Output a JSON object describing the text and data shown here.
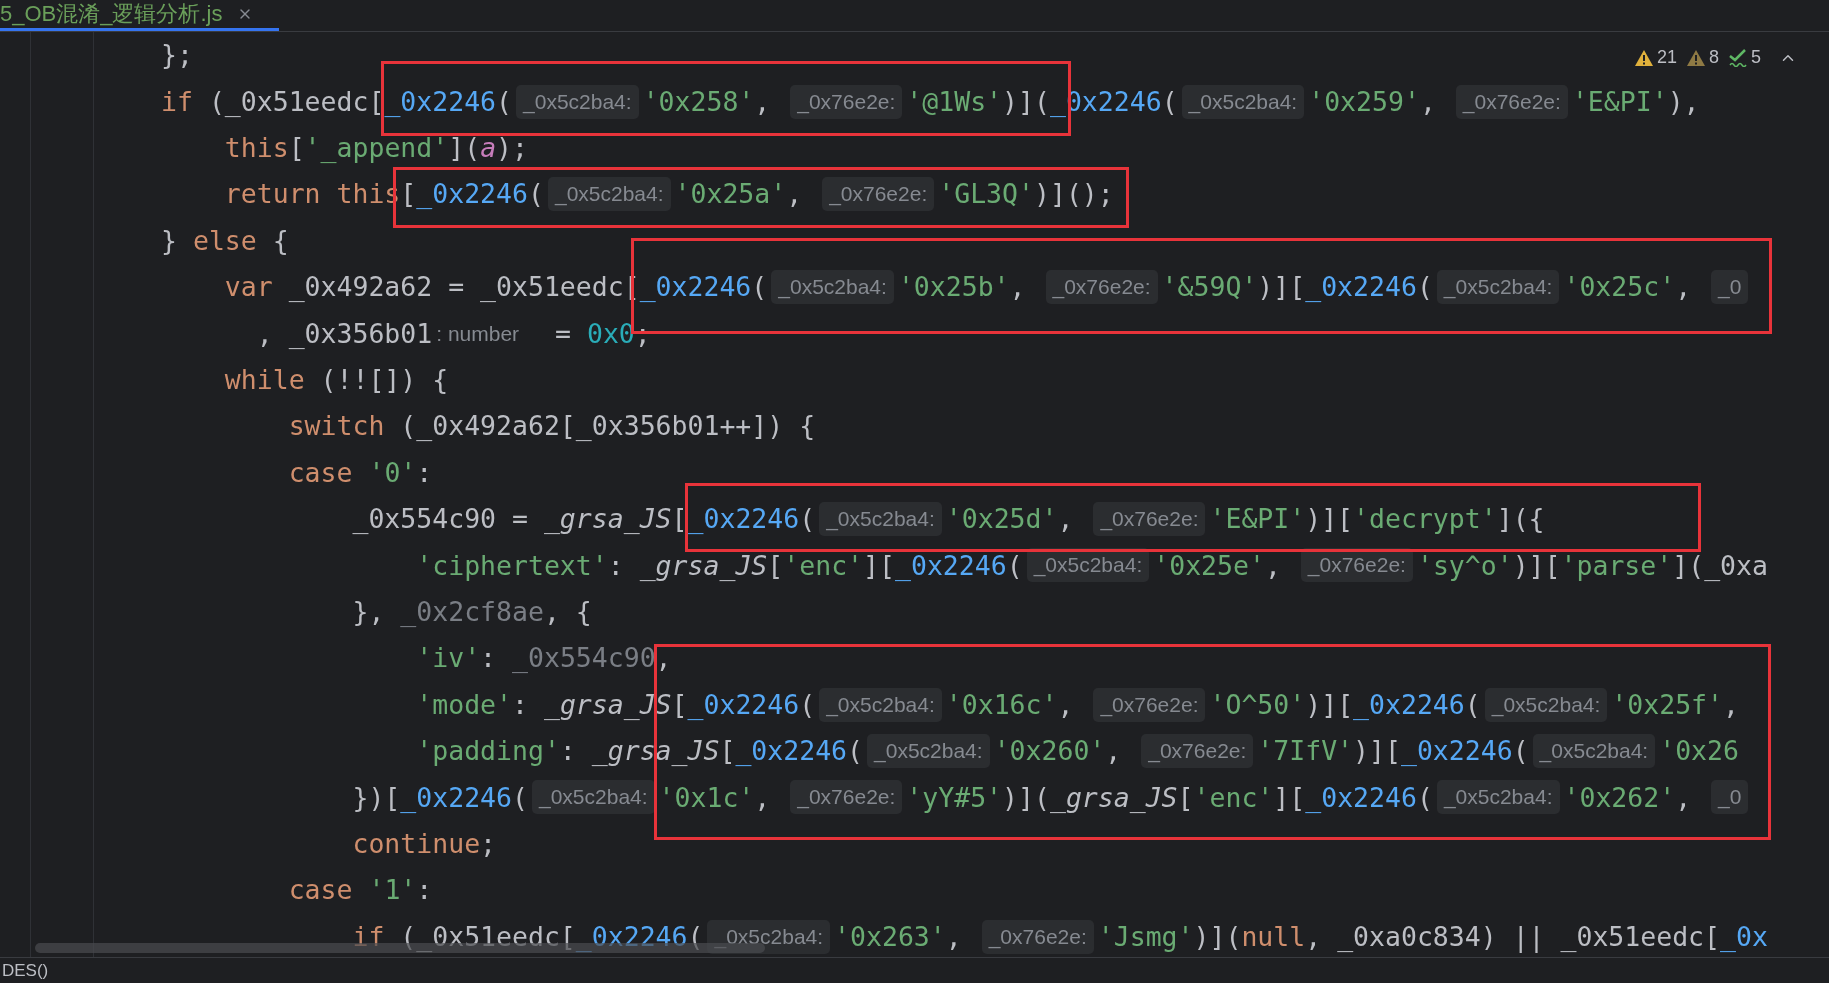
{
  "tab": {
    "title": "5_OB混淆_逻辑分析.js",
    "selected": true
  },
  "inspections": [
    {
      "kind": "warning",
      "count": "21"
    },
    {
      "kind": "weak_warning",
      "count": "8"
    },
    {
      "kind": "typo",
      "count": "5"
    }
  ],
  "code_lines": [
    [
      {
        "kind": "plain",
        "text": "};"
      }
    ],
    [
      {
        "kind": "keyword",
        "text": "if"
      },
      {
        "kind": "plain",
        "text": " (_0x51eedc["
      },
      {
        "kind": "fn",
        "text": "_0x2246"
      },
      {
        "kind": "plain",
        "text": "("
      },
      {
        "kind": "hint",
        "text": "_0x5c2ba4:"
      },
      {
        "kind": "string",
        "text": "'0x258'"
      },
      {
        "kind": "plain",
        "text": ", "
      },
      {
        "kind": "hint",
        "text": "_0x76e2e:"
      },
      {
        "kind": "string",
        "text": "'@1Ws'"
      },
      {
        "kind": "plain",
        "text": ")]("
      },
      {
        "kind": "fn",
        "text": "_0x2246"
      },
      {
        "kind": "plain",
        "text": "("
      },
      {
        "kind": "hint",
        "text": "_0x5c2ba4:"
      },
      {
        "kind": "string",
        "text": "'0x259'"
      },
      {
        "kind": "plain",
        "text": ", "
      },
      {
        "kind": "hint",
        "text": "_0x76e2e:"
      },
      {
        "kind": "string",
        "text": "'E&PI'"
      },
      {
        "kind": "plain",
        "text": "),"
      }
    ],
    [
      {
        "kind": "keyword",
        "text": "    this"
      },
      {
        "kind": "plain",
        "text": "["
      },
      {
        "kind": "string",
        "text": "'_append'"
      },
      {
        "kind": "plain",
        "text": "]("
      },
      {
        "kind": "param",
        "text": "a"
      },
      {
        "kind": "plain",
        "text": ");"
      }
    ],
    [
      {
        "kind": "keyword",
        "text": "    return this"
      },
      {
        "kind": "plain",
        "text": "["
      },
      {
        "kind": "fn",
        "text": "_0x2246"
      },
      {
        "kind": "plain",
        "text": "("
      },
      {
        "kind": "hint",
        "text": "_0x5c2ba4:"
      },
      {
        "kind": "string",
        "text": "'0x25a'"
      },
      {
        "kind": "plain",
        "text": ", "
      },
      {
        "kind": "hint",
        "text": "_0x76e2e:"
      },
      {
        "kind": "string",
        "text": "'GL3Q'"
      },
      {
        "kind": "plain",
        "text": ")]();"
      }
    ],
    [
      {
        "kind": "plain",
        "text": "} "
      },
      {
        "kind": "keyword",
        "text": "else"
      },
      {
        "kind": "plain",
        "text": " {"
      }
    ],
    [
      {
        "kind": "keyword",
        "text": "    var"
      },
      {
        "kind": "plain",
        "text": " _0x492a62 = _0x51eedc["
      },
      {
        "kind": "fn",
        "text": "_0x2246"
      },
      {
        "kind": "plain",
        "text": "("
      },
      {
        "kind": "hint",
        "text": "_0x5c2ba4:"
      },
      {
        "kind": "string",
        "text": "'0x25b'"
      },
      {
        "kind": "plain",
        "text": ", "
      },
      {
        "kind": "hint",
        "text": "_0x76e2e:"
      },
      {
        "kind": "string",
        "text": "'&59Q'"
      },
      {
        "kind": "plain",
        "text": ")]["
      },
      {
        "kind": "fn",
        "text": "_0x2246"
      },
      {
        "kind": "plain",
        "text": "("
      },
      {
        "kind": "hint",
        "text": "_0x5c2ba4:"
      },
      {
        "kind": "string",
        "text": "'0x25c'"
      },
      {
        "kind": "plain",
        "text": ", "
      },
      {
        "kind": "hint",
        "text": "_0"
      }
    ],
    [
      {
        "kind": "plain",
        "text": "      , _0x356b01"
      },
      {
        "kind": "typehint",
        "text": ": number"
      },
      {
        "kind": "plain",
        "text": "  = "
      },
      {
        "kind": "number",
        "text": "0x0"
      },
      {
        "kind": "plain",
        "text": ";"
      }
    ],
    [
      {
        "kind": "keyword",
        "text": "    while"
      },
      {
        "kind": "plain",
        "text": " (!![]) {"
      }
    ],
    [
      {
        "kind": "keyword",
        "text": "        switch"
      },
      {
        "kind": "plain",
        "text": " (_0x492a62[_0x356b01++]) {"
      }
    ],
    [
      {
        "kind": "keyword",
        "text": "        case "
      },
      {
        "kind": "string",
        "text": "'0'"
      },
      {
        "kind": "plain",
        "text": ":"
      }
    ],
    [
      {
        "kind": "plain",
        "text": "            _0x554c90 = "
      },
      {
        "kind": "global",
        "text": "_grsa_JS"
      },
      {
        "kind": "plain",
        "text": "["
      },
      {
        "kind": "fn",
        "text": "_0x2246"
      },
      {
        "kind": "plain",
        "text": "("
      },
      {
        "kind": "hint",
        "text": "_0x5c2ba4:"
      },
      {
        "kind": "string",
        "text": "'0x25d'"
      },
      {
        "kind": "plain",
        "text": ", "
      },
      {
        "kind": "hint",
        "text": "_0x76e2e:"
      },
      {
        "kind": "string",
        "text": "'E&PI'"
      },
      {
        "kind": "plain",
        "text": ")]["
      },
      {
        "kind": "string",
        "text": "'decrypt'"
      },
      {
        "kind": "plain",
        "text": "]({"
      }
    ],
    [
      {
        "kind": "string",
        "text": "                'ciphertext'"
      },
      {
        "kind": "plain",
        "text": ": "
      },
      {
        "kind": "global",
        "text": "_grsa_JS"
      },
      {
        "kind": "plain",
        "text": "["
      },
      {
        "kind": "string",
        "text": "'enc'"
      },
      {
        "kind": "plain",
        "text": "]["
      },
      {
        "kind": "fn",
        "text": "_0x2246"
      },
      {
        "kind": "plain",
        "text": "("
      },
      {
        "kind": "hint",
        "text": "_0x5c2ba4:"
      },
      {
        "kind": "string",
        "text": "'0x25e'"
      },
      {
        "kind": "plain",
        "text": ", "
      },
      {
        "kind": "hint",
        "text": "_0x76e2e:"
      },
      {
        "kind": "string",
        "text": "'sy^o'"
      },
      {
        "kind": "plain",
        "text": ")]["
      },
      {
        "kind": "string",
        "text": "'parse'"
      },
      {
        "kind": "plain",
        "text": "](_0xa"
      }
    ],
    [
      {
        "kind": "plain",
        "text": "            }, "
      },
      {
        "kind": "unused",
        "text": "_0x2cf8ae"
      },
      {
        "kind": "plain",
        "text": ", {"
      }
    ],
    [
      {
        "kind": "string",
        "text": "                'iv'"
      },
      {
        "kind": "plain",
        "text": ": "
      },
      {
        "kind": "unused",
        "text": "_0x554c90"
      },
      {
        "kind": "plain",
        "text": ","
      }
    ],
    [
      {
        "kind": "string",
        "text": "                'mode'"
      },
      {
        "kind": "plain",
        "text": ": "
      },
      {
        "kind": "global",
        "text": "_grsa_JS"
      },
      {
        "kind": "plain",
        "text": "["
      },
      {
        "kind": "fn",
        "text": "_0x2246"
      },
      {
        "kind": "plain",
        "text": "("
      },
      {
        "kind": "hint",
        "text": "_0x5c2ba4:"
      },
      {
        "kind": "string",
        "text": "'0x16c'"
      },
      {
        "kind": "plain",
        "text": ", "
      },
      {
        "kind": "hint",
        "text": "_0x76e2e:"
      },
      {
        "kind": "string",
        "text": "'O^50'"
      },
      {
        "kind": "plain",
        "text": ")]["
      },
      {
        "kind": "fn",
        "text": "_0x2246"
      },
      {
        "kind": "plain",
        "text": "("
      },
      {
        "kind": "hint",
        "text": "_0x5c2ba4:"
      },
      {
        "kind": "string",
        "text": "'0x25f'"
      },
      {
        "kind": "plain",
        "text": ","
      }
    ],
    [
      {
        "kind": "string",
        "text": "                'padding'"
      },
      {
        "kind": "plain",
        "text": ": "
      },
      {
        "kind": "global",
        "text": "_grsa_JS"
      },
      {
        "kind": "plain",
        "text": "["
      },
      {
        "kind": "fn",
        "text": "_0x2246"
      },
      {
        "kind": "plain",
        "text": "("
      },
      {
        "kind": "hint",
        "text": "_0x5c2ba4:"
      },
      {
        "kind": "string",
        "text": "'0x260'"
      },
      {
        "kind": "plain",
        "text": ", "
      },
      {
        "kind": "hint",
        "text": "_0x76e2e:"
      },
      {
        "kind": "string",
        "text": "'7IfV'"
      },
      {
        "kind": "plain",
        "text": ")]["
      },
      {
        "kind": "fn",
        "text": "_0x2246"
      },
      {
        "kind": "plain",
        "text": "("
      },
      {
        "kind": "hint",
        "text": "_0x5c2ba4:"
      },
      {
        "kind": "string",
        "text": "'0x26"
      }
    ],
    [
      {
        "kind": "plain",
        "text": "            })["
      },
      {
        "kind": "fn",
        "text": "_0x2246"
      },
      {
        "kind": "plain",
        "text": "("
      },
      {
        "kind": "hint",
        "text": "_0x5c2ba4:"
      },
      {
        "kind": "string",
        "text": "'0x1c'"
      },
      {
        "kind": "plain",
        "text": ", "
      },
      {
        "kind": "hint",
        "text": "_0x76e2e:"
      },
      {
        "kind": "string",
        "text": "'yY#5'"
      },
      {
        "kind": "plain",
        "text": ")]("
      },
      {
        "kind": "global",
        "text": "_grsa_JS"
      },
      {
        "kind": "plain",
        "text": "["
      },
      {
        "kind": "string",
        "text": "'enc'"
      },
      {
        "kind": "plain",
        "text": "]["
      },
      {
        "kind": "fn",
        "text": "_0x2246"
      },
      {
        "kind": "plain",
        "text": "("
      },
      {
        "kind": "hint",
        "text": "_0x5c2ba4:"
      },
      {
        "kind": "string",
        "text": "'0x262'"
      },
      {
        "kind": "plain",
        "text": ", "
      },
      {
        "kind": "hint",
        "text": "_0"
      }
    ],
    [
      {
        "kind": "keyword",
        "text": "            continue"
      },
      {
        "kind": "plain",
        "text": ";"
      }
    ],
    [
      {
        "kind": "keyword",
        "text": "        case "
      },
      {
        "kind": "string",
        "text": "'1'"
      },
      {
        "kind": "plain",
        "text": ":"
      }
    ],
    [
      {
        "kind": "keyword",
        "text": "            if"
      },
      {
        "kind": "plain",
        "text": " (_0x51eedc["
      },
      {
        "kind": "fn",
        "text": "_0x2246"
      },
      {
        "kind": "plain",
        "text": "("
      },
      {
        "kind": "hint",
        "text": "_0x5c2ba4:"
      },
      {
        "kind": "string",
        "text": "'0x263'"
      },
      {
        "kind": "plain",
        "text": ", "
      },
      {
        "kind": "hint",
        "text": "_0x76e2e:"
      },
      {
        "kind": "string",
        "text": "'Jsmg'"
      },
      {
        "kind": "plain",
        "text": ")]("
      },
      {
        "kind": "keyword",
        "text": "null"
      },
      {
        "kind": "plain",
        "text": ", _0xa0c834) || _0x51eedc["
      },
      {
        "kind": "fn",
        "text": "_0x"
      }
    ]
  ],
  "status_bar": {
    "text": "DES()"
  }
}
